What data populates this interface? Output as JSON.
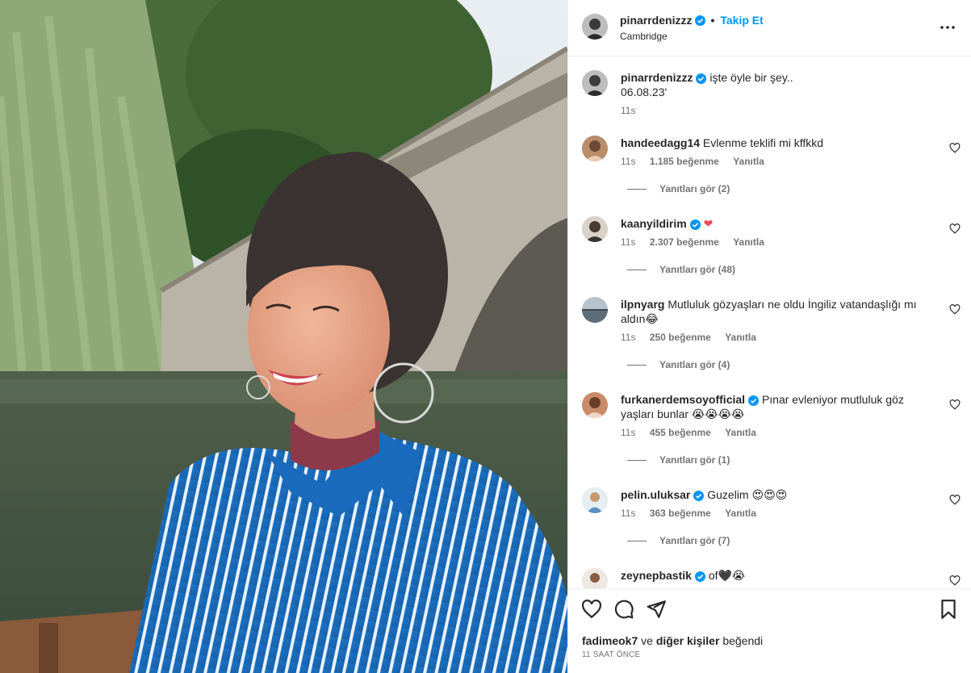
{
  "post": {
    "username": "pinarrdenizzz",
    "follow_label": "Takip Et",
    "dot": "•",
    "location": "Cambridge"
  },
  "caption": {
    "username": "pinarrdenizzz",
    "text": "işte öyle bir şey..",
    "date": "06.08.23'",
    "time": "11s"
  },
  "comments": [
    {
      "username": "handeedagg14",
      "text": "Evlenme teklifi mi kffkkd",
      "time": "11s",
      "likes": "1.185 beğenme",
      "reply": "Yanıtla",
      "replies": "Yanıtları gör (2)"
    },
    {
      "username": "kaanyildirim",
      "text": "❤",
      "time": "11s",
      "likes": "2.307 beğenme",
      "reply": "Yanıtla",
      "replies": "Yanıtları gör (48)"
    },
    {
      "username": "ilpnyarg",
      "text": "Mutluluk gözyaşları ne oldu İngiliz vatandaşlığı mı aldın😂",
      "time": "11s",
      "likes": "250 beğenme",
      "reply": "Yanıtla",
      "replies": "Yanıtları gör (4)"
    },
    {
      "username": "furkanerdemsoyofficial",
      "text": "Pınar evleniyor mutluluk göz yaşları bunlar 😭😭😭😭",
      "time": "11s",
      "likes": "455 beğenme",
      "reply": "Yanıtla",
      "replies": "Yanıtları gör (1)"
    },
    {
      "username": "pelin.uluksar",
      "text": "Guzelim 😍😍😍",
      "time": "11s",
      "likes": "363 beğenme",
      "reply": "Yanıtla",
      "replies": "Yanıtları gör (7)"
    },
    {
      "username": "zeynepbastik",
      "text": "of🖤😭"
    }
  ],
  "footer": {
    "liked_by_user": "fadimeok7",
    "liked_and": "ve",
    "liked_others": "diğer kişiler",
    "liked_suffix": "beğendi",
    "timestamp": "11 SAAT ÖNCE"
  },
  "colors": {
    "accent": "#0095f6",
    "text": "#262626",
    "muted": "#737373",
    "heart": "#ed4956"
  },
  "icons": [
    "verified-badge-icon",
    "more-options-icon",
    "heart-icon",
    "comment-icon",
    "share-icon",
    "bookmark-icon"
  ]
}
